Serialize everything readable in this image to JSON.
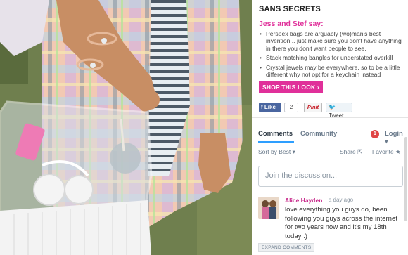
{
  "article": {
    "heading": "SANS SECRETS",
    "say": "Jess and Stef say:",
    "tips": [
      "Perspex bags are arguably (wo)man's best invention... just make sure you don't have anything in there you don't want people to see.",
      "Stack matching bangles for understated overkill",
      "Crystal jewels may be everywhere, so to be a little different why not opt for a keychain instead"
    ],
    "shop_label": "SHOP THIS LOOK ›"
  },
  "social": {
    "like_label": "Like",
    "like_count": "2",
    "pin_label": "Pinit",
    "tweet_label": "Tweet"
  },
  "comments": {
    "tab_comments": "Comments",
    "tab_community": "Community",
    "notification_count": "1",
    "login_label": "Login ▾",
    "sort_label": "Sort by Best ▾",
    "share_label": "Share",
    "favorite_label": "Favorite ★",
    "discussion_placeholder": "Join the discussion...",
    "items": [
      {
        "author": "Alice Hayden",
        "time": "· a day ago",
        "text": "love everything you guys do, been following you guys across the internet for two years now and it's my 18th today :)"
      }
    ],
    "expand_label": "EXPAND COMMENTS"
  },
  "colors": {
    "accent_pink": "#e0309a",
    "facebook_blue": "#4a66a0",
    "tab_blue": "#2e9fff"
  }
}
